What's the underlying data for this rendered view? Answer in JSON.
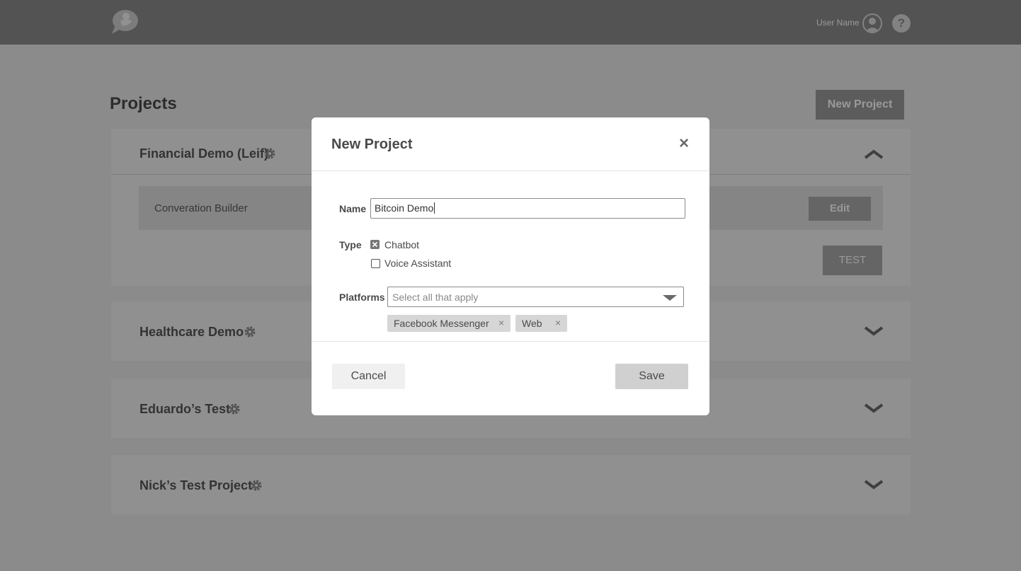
{
  "header": {
    "logo_icon": "speech-bubble-bird-logo",
    "user_name": "User Name",
    "help_label": "?"
  },
  "page": {
    "title": "Projects",
    "new_project_label": "New Project"
  },
  "projects": [
    {
      "title": "Financial Demo (Leif)",
      "expanded": true,
      "builder_label": "Converation Builder",
      "edit_label": "Edit",
      "test_label": "TEST"
    },
    {
      "title": "Healthcare Demo",
      "expanded": false
    },
    {
      "title": "Eduardo’s Test",
      "expanded": false
    },
    {
      "title": "Nick’s Test Project",
      "expanded": false
    }
  ],
  "modal": {
    "title": "New Project",
    "close_label": "×",
    "name_label": "Name",
    "name_value": "Bitcoin Demo",
    "type_label": "Type",
    "types": [
      {
        "label": "Chatbot",
        "checked": true
      },
      {
        "label": "Voice Assistant",
        "checked": false
      }
    ],
    "platforms_label": "Platforms",
    "platforms_placeholder": "Select all that apply",
    "selected_platforms": [
      {
        "label": "Facebook Messenger",
        "remove": "×"
      },
      {
        "label": "Web",
        "remove": "×"
      }
    ],
    "cancel_label": "Cancel",
    "save_label": "Save"
  },
  "colors": {
    "topbar": "#8a8a8a",
    "page_bg": "#e8e8e8",
    "card_bg": "#f0f0f0",
    "button_gray": "#9a9a9a"
  }
}
